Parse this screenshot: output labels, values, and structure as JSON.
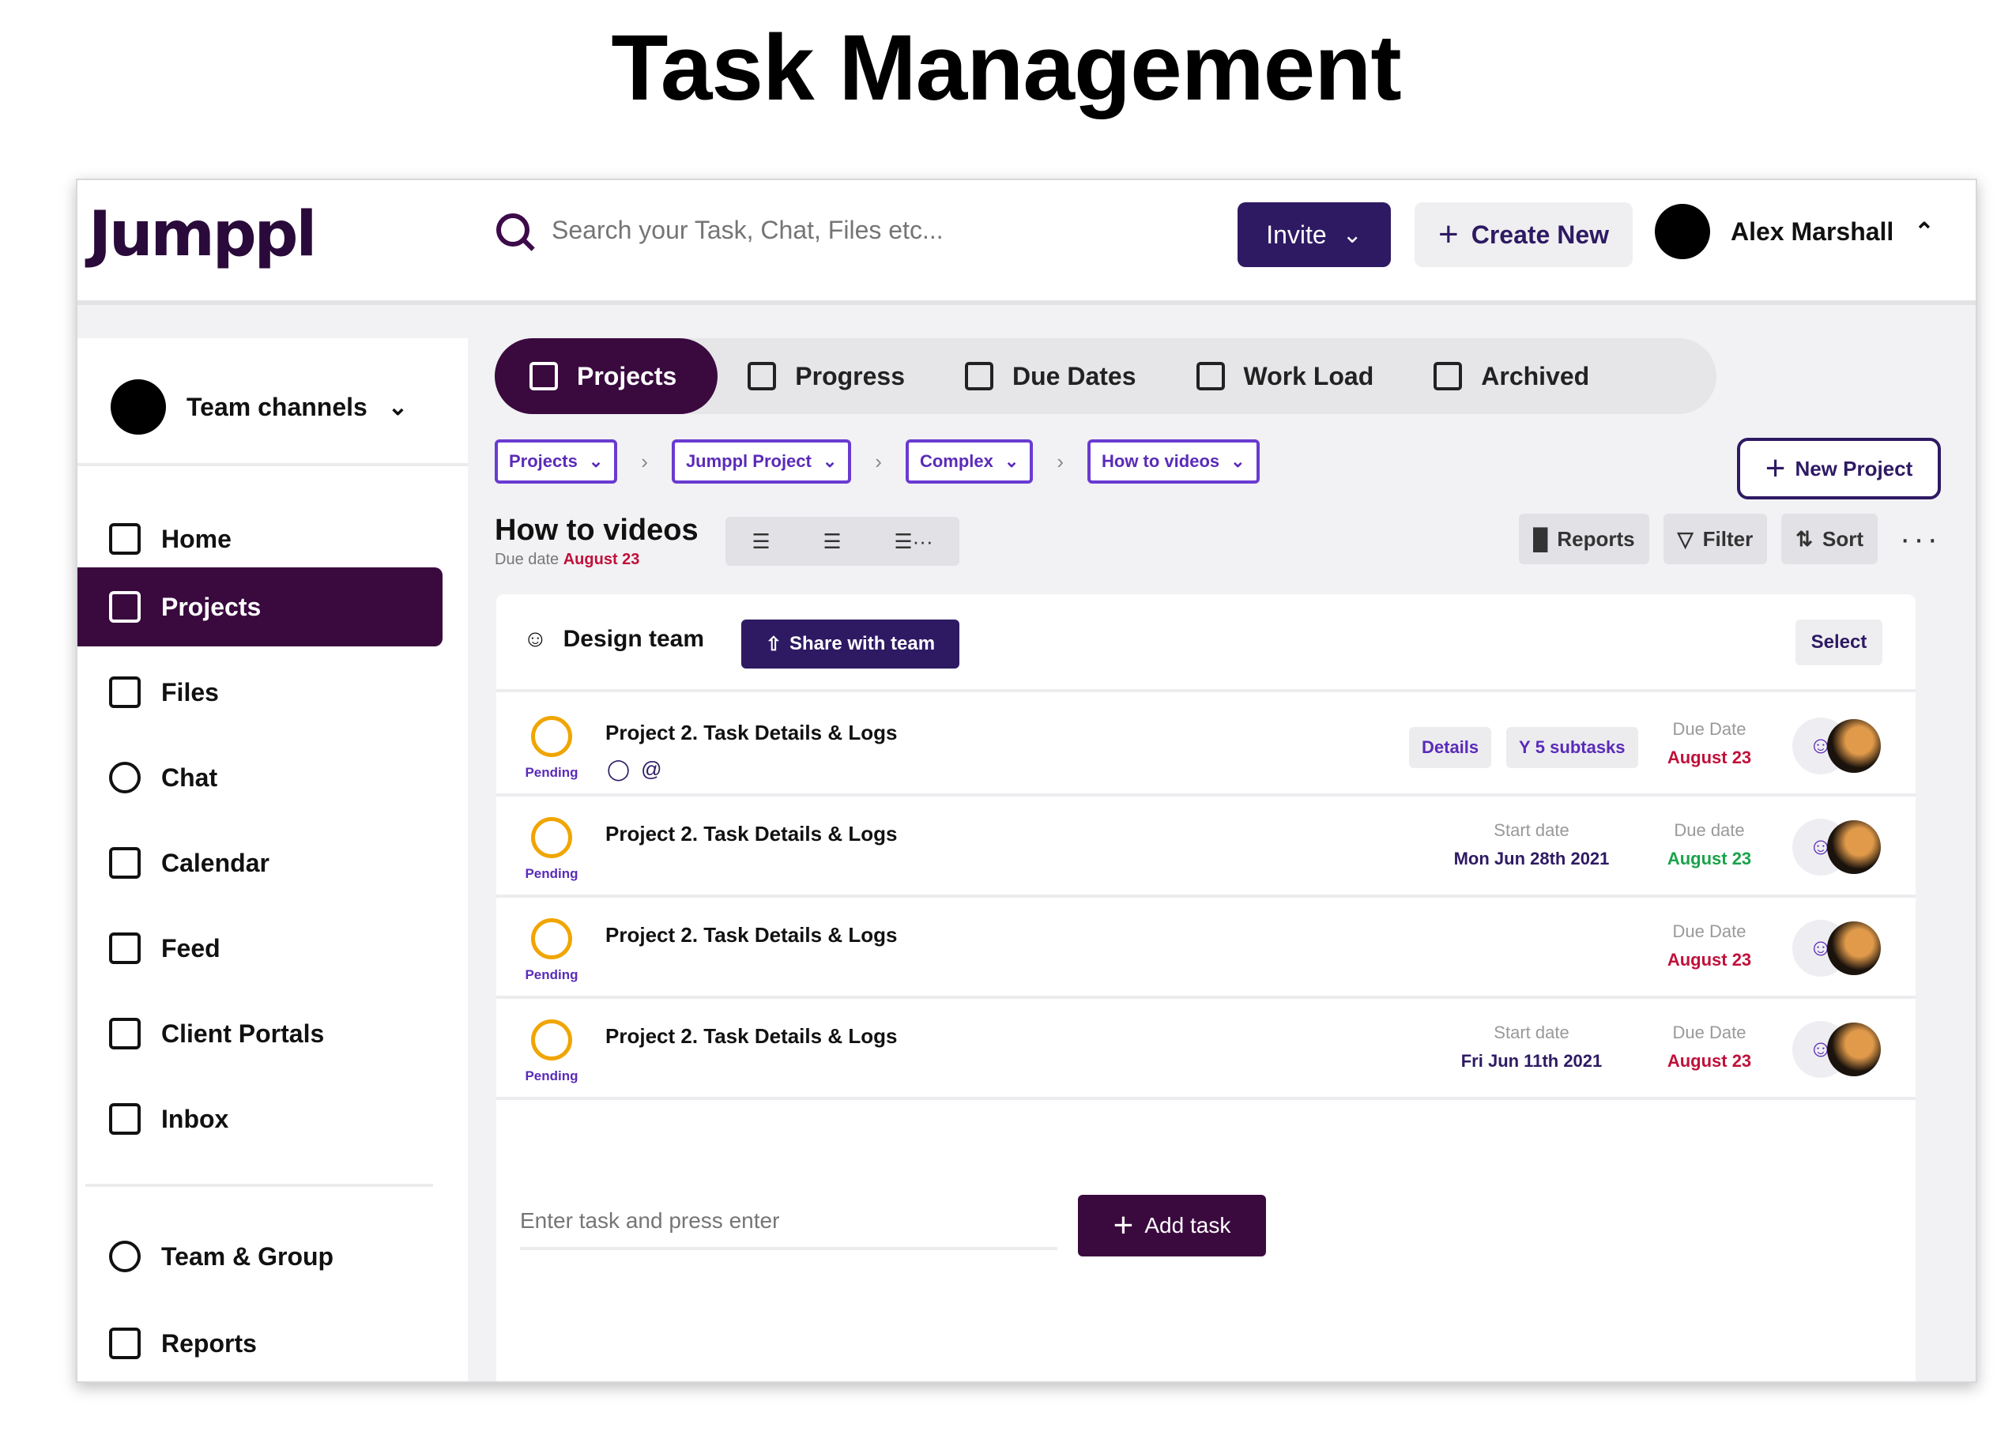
{
  "heading": "Task Management",
  "topbar": {
    "logo": "Jumppl",
    "search_placeholder": "Search your Task, Chat, Files etc...",
    "invite_label": "Invite",
    "create_label": "Create New",
    "user_name": "Alex Marshall"
  },
  "sidebar": {
    "team_channels": "Team channels",
    "items": [
      {
        "label": "Home"
      },
      {
        "label": "Projects"
      },
      {
        "label": "Files"
      },
      {
        "label": "Chat"
      },
      {
        "label": "Calendar"
      },
      {
        "label": "Feed"
      },
      {
        "label": "Client Portals"
      },
      {
        "label": "Inbox"
      },
      {
        "label": "Team & Group"
      },
      {
        "label": "Reports"
      }
    ]
  },
  "tabs": [
    {
      "label": "Projects"
    },
    {
      "label": "Progress"
    },
    {
      "label": "Due Dates"
    },
    {
      "label": "Work Load"
    },
    {
      "label": "Archived"
    }
  ],
  "breadcrumbs": [
    "Projects",
    "Jumppl Project",
    "Complex",
    "How to videos"
  ],
  "new_project_label": "New Project",
  "page": {
    "title": "How to videos",
    "due_label": "Due date",
    "due_value": "August 23"
  },
  "tools": {
    "reports": "Reports",
    "filter": "Filter",
    "sort": "Sort"
  },
  "panel": {
    "team_name": "Design team",
    "share_label": "Share with team",
    "select_label": "Select"
  },
  "tasks": [
    {
      "title": "Project 2. Task Details & Logs",
      "status": "Pending",
      "details_chip": "Details",
      "subtasks_chip": "5 subtasks",
      "due_label": "Due Date",
      "due_value": "August 23"
    },
    {
      "title": "Project 2. Task Details & Logs",
      "status": "Pending",
      "start_label": "Start date",
      "start_value": "Mon Jun 28th 2021",
      "due_label": "Due date",
      "due_value": "August 23"
    },
    {
      "title": "Project 2. Task Details & Logs",
      "status": "Pending",
      "due_label": "Due Date",
      "due_value": "August 23"
    },
    {
      "title": "Project 2. Task Details & Logs",
      "status": "Pending",
      "start_label": "Start date",
      "start_value": "Fri Jun 11th 2021",
      "due_label": "Due Date",
      "due_value": "August 23"
    }
  ],
  "add_task": {
    "placeholder": "Enter task and press enter",
    "button_label": "Add task"
  },
  "colors": {
    "primary": "#3a0a3f",
    "navy": "#2e1a63",
    "pending": "#f0a500",
    "due_red": "#c0103a",
    "due_green": "#1aa34a",
    "chip_text": "#5a2bb8"
  }
}
